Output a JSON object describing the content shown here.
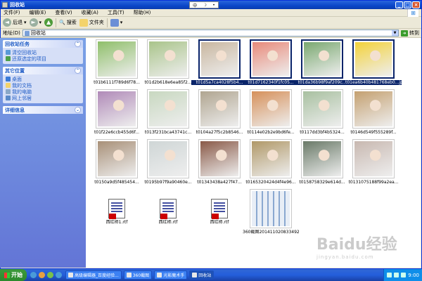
{
  "window": {
    "title": "回收站"
  },
  "ime": {
    "label": "中"
  },
  "menu": [
    "文件(F)",
    "编辑(E)",
    "查看(V)",
    "收藏(A)",
    "工具(T)",
    "帮助(H)"
  ],
  "toolbar": {
    "back": "后退",
    "search": "搜索",
    "folders": "文件夹"
  },
  "address": {
    "label": "地址(D)",
    "value": "回收站",
    "go": "转到"
  },
  "sidebar": {
    "tasks": {
      "title": "回收站任务",
      "items": [
        "清空回收站",
        "还原选定的项目"
      ]
    },
    "places": {
      "title": "其它位置",
      "items": [
        "桌面",
        "我的文档",
        "我的电脑",
        "网上邻居"
      ]
    },
    "details": {
      "title": "详细信息"
    }
  },
  "files": [
    {
      "name": "t01b6111f789d6f78...",
      "selected": false,
      "type": "image",
      "color": "#8fbf6a"
    },
    {
      "name": "t01d2b618e6ea85f2...",
      "selected": false,
      "type": "image",
      "color": "#a9c48a"
    },
    {
      "name": "t01d5a7ca4028f5b4...",
      "selected": true,
      "type": "image",
      "color": "#c9b7a0"
    },
    {
      "name": "t01d7162340f1fc05...",
      "selected": true,
      "type": "image",
      "color": "#e88a7a"
    },
    {
      "name": "t01da36b98f9af209c...",
      "selected": true,
      "type": "image",
      "color": "#7aa870"
    },
    {
      "name": "t01ea6b40b481768eb0...jpg",
      "selected": true,
      "type": "image",
      "color": "#f3d23a"
    },
    {
      "name": "t01f22e6ccb455d6f...",
      "selected": false,
      "type": "image",
      "color": "#b08ab8"
    },
    {
      "name": "t013f231bca43741c...",
      "selected": false,
      "type": "image",
      "color": "#c8d8c0"
    },
    {
      "name": "t0104a27f5c2b8546...",
      "selected": false,
      "type": "image",
      "color": "#b0a590"
    },
    {
      "name": "t0114e02b2e9bd6fe...",
      "selected": false,
      "type": "image",
      "color": "#d6905a"
    },
    {
      "name": "t0117dd3bf4b5324...",
      "selected": false,
      "type": "image",
      "color": "#a8c0a0"
    },
    {
      "name": "t0146d549f555289f...",
      "selected": false,
      "type": "image",
      "color": "#c4a070"
    },
    {
      "name": "t0150a9d5f485454...",
      "selected": false,
      "type": "image",
      "color": "#a89078"
    },
    {
      "name": "t0195b97f9a90460e...",
      "selected": false,
      "type": "image",
      "color": "#cfd6d6"
    },
    {
      "name": "t01343438a427f47...",
      "selected": false,
      "type": "image",
      "color": "#8a5a48"
    },
    {
      "name": "t0165320424d4f4e96...",
      "selected": false,
      "type": "image",
      "color": "#b09868"
    },
    {
      "name": "t0158758329e614d...",
      "selected": false,
      "type": "image",
      "color": "#6a7a68"
    },
    {
      "name": "t0131075188f99a2ea...",
      "selected": false,
      "type": "image",
      "color": "#c8b8b0"
    },
    {
      "name": "西红柿1.rtf",
      "selected": false,
      "type": "doc"
    },
    {
      "name": "西红柿.rtf",
      "selected": false,
      "type": "doc"
    },
    {
      "name": "西红柿.rtf",
      "selected": false,
      "type": "doc"
    },
    {
      "name": "360截图20141102083349281...",
      "selected": false,
      "type": "screenshot"
    }
  ],
  "taskbar": {
    "start": "开始",
    "tasks": [
      {
        "label": "高级编辑器_百度经验...",
        "active": false
      },
      {
        "label": "360截图",
        "active": false
      },
      {
        "label": "光影魔术手",
        "active": false
      },
      {
        "label": "回收站",
        "active": true
      }
    ],
    "clock": "9:00"
  },
  "watermark": {
    "text": "Baidu经验",
    "url": "jingyan.baidu.com"
  },
  "colors": {
    "titlebar": "#0a46c8",
    "sidebar": "#6f8fe0",
    "selection": "#0a246a",
    "taskbar": "#245edb",
    "start": "#3c9a3c"
  }
}
